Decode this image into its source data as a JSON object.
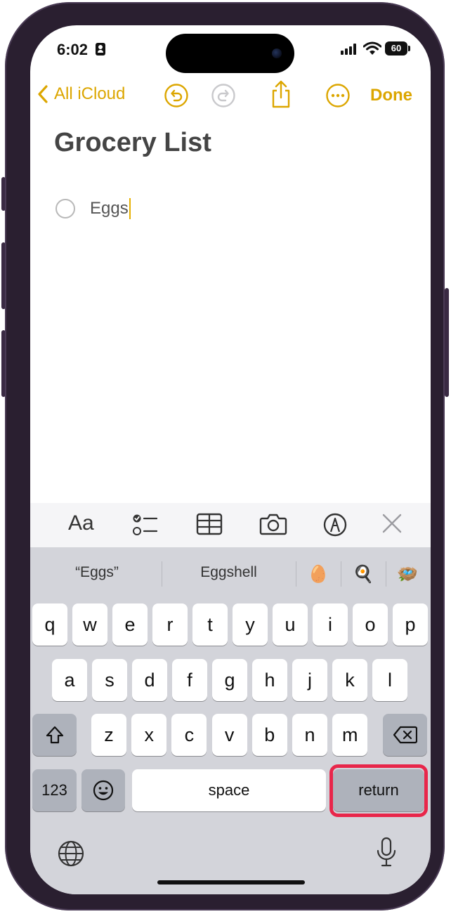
{
  "status_bar": {
    "time": "6:02",
    "battery": "60"
  },
  "nav": {
    "back_label": "All iCloud",
    "done_label": "Done"
  },
  "note": {
    "title": "Grocery List",
    "checklist": [
      {
        "text": "Eggs",
        "checked": false
      }
    ]
  },
  "toolbar": {
    "format_label": "Aa"
  },
  "keyboard": {
    "suggestions": [
      "“Eggs”",
      "Eggshell"
    ],
    "emoji_suggestions": [
      "🥚",
      "🍳",
      "🪺"
    ],
    "row1": [
      "q",
      "w",
      "e",
      "r",
      "t",
      "y",
      "u",
      "i",
      "o",
      "p"
    ],
    "row2": [
      "a",
      "s",
      "d",
      "f",
      "g",
      "h",
      "j",
      "k",
      "l"
    ],
    "row3": [
      "z",
      "x",
      "c",
      "v",
      "b",
      "n",
      "m"
    ],
    "numbers_label": "123",
    "space_label": "space",
    "return_label": "return"
  },
  "colors": {
    "accent": "#dca600",
    "highlight": "#e8264a",
    "keyboard_bg": "#d3d4da"
  }
}
